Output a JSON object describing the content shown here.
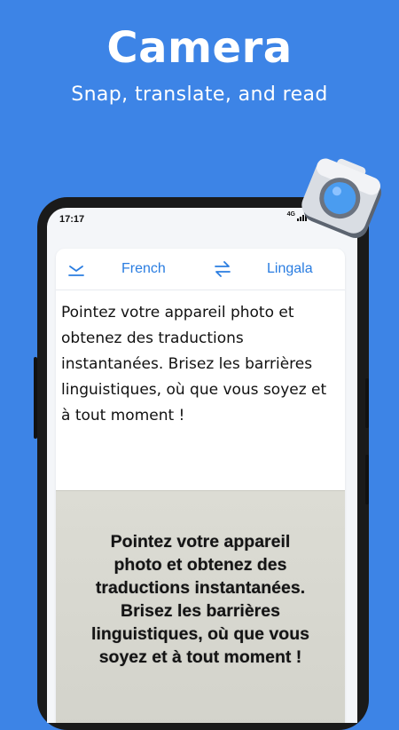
{
  "promo": {
    "title": "Camera",
    "subtitle": "Snap, translate, and read"
  },
  "status_bar": {
    "time": "17:17",
    "network": "4G"
  },
  "language_bar": {
    "source_language": "French",
    "target_language": "Lingala"
  },
  "source_text": "Pointez votre appareil photo et obtenez des traductions instantanées. Brisez les barrières linguistiques, où que vous soyez et à tout moment !",
  "photo_text": {
    "lines": [
      "Pointez votre appareil",
      "photo et obtenez des",
      "traductions instantanées.",
      "Brisez les barrières",
      "linguistiques, où que vous",
      "soyez et à tout moment !"
    ]
  },
  "colors": {
    "background": "#3d84e6",
    "accent": "#2a7de1",
    "camera_lens": "#4a9cf0"
  },
  "icons": {
    "collapse": "chevron-down-icon",
    "swap": "swap-icon",
    "camera": "camera-icon"
  }
}
